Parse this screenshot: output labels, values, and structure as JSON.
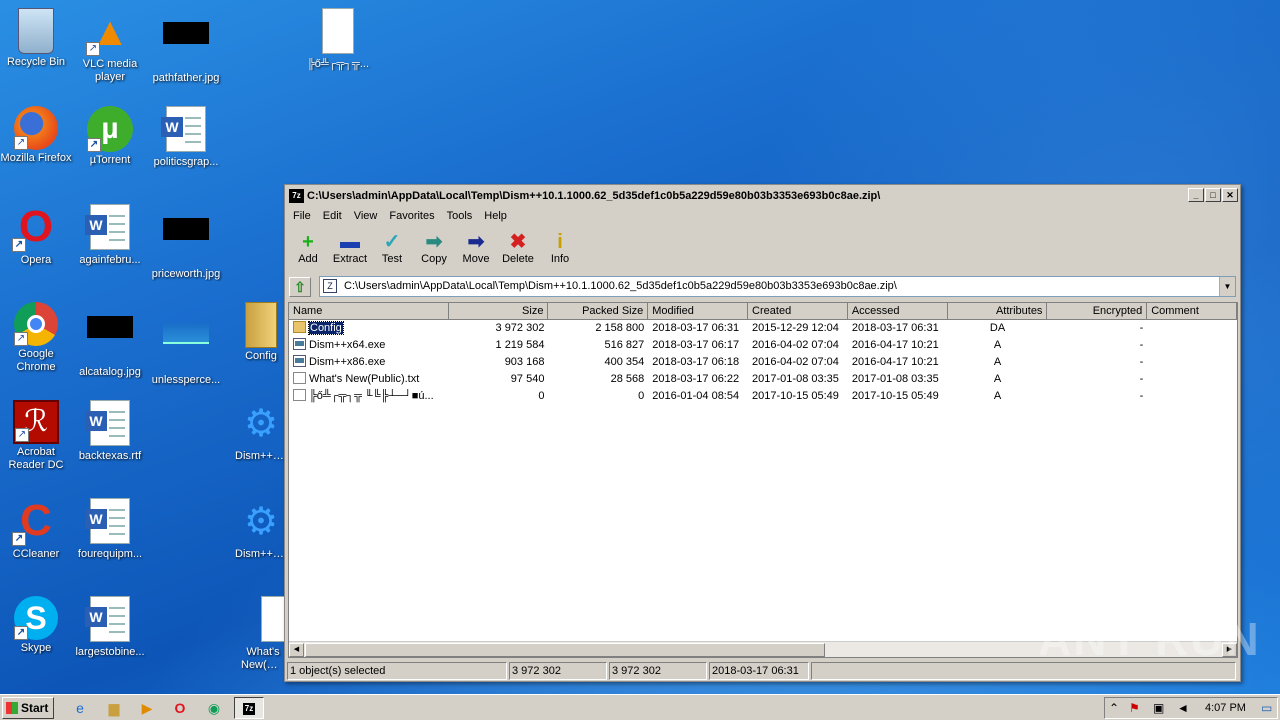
{
  "desktop": {
    "icons": [
      {
        "label": "Recycle Bin"
      },
      {
        "label": "VLC media player"
      },
      {
        "label": "pathfather.jpg"
      },
      {
        "label": "╠ő╩┌╦┐╦..."
      },
      {
        "label": "Mozilla Firefox"
      },
      {
        "label": "µTorrent"
      },
      {
        "label": "politicsgrap..."
      },
      {
        "label": "Opera"
      },
      {
        "label": "againfebru..."
      },
      {
        "label": "priceworth.jpg"
      },
      {
        "label": "Google Chrome"
      },
      {
        "label": "alcatalog.jpg"
      },
      {
        "label": "unlessperce..."
      },
      {
        "label": "Config"
      },
      {
        "label": "Acrobat Reader DC"
      },
      {
        "label": "backtexas.rtf"
      },
      {
        "label": "Dism++x6..."
      },
      {
        "label": "CCleaner"
      },
      {
        "label": "fourequipm..."
      },
      {
        "label": "Dism++x8..."
      },
      {
        "label": "Skype"
      },
      {
        "label": "largestobine..."
      },
      {
        "label": "What's New(Public)..."
      }
    ]
  },
  "window": {
    "title": "C:\\Users\\admin\\AppData\\Local\\Temp\\Dism++10.1.1000.62_5d35def1c0b5a229d59e80b03b3353e693b0c8ae.zip\\",
    "app_icon": "7z",
    "menu": [
      "File",
      "Edit",
      "View",
      "Favorites",
      "Tools",
      "Help"
    ],
    "toolbar": [
      {
        "label": "Add",
        "icon": "+",
        "color": "#19b019"
      },
      {
        "label": "Extract",
        "icon": "▬",
        "color": "#1a3fb0"
      },
      {
        "label": "Test",
        "icon": "✓",
        "color": "#29a8b8"
      },
      {
        "label": "Copy",
        "icon": "➡",
        "color": "#2a8a80"
      },
      {
        "label": "Move",
        "icon": "➡",
        "color": "#1a2a90"
      },
      {
        "label": "Delete",
        "icon": "✖",
        "color": "#d42020"
      },
      {
        "label": "Info",
        "icon": "i",
        "color": "#c8a000"
      }
    ],
    "address": "C:\\Users\\admin\\AppData\\Local\\Temp\\Dism++10.1.1000.62_5d35def1c0b5a229d59e80b03b3353e693b0c8ae.zip\\",
    "columns": [
      "Name",
      "Size",
      "Packed Size",
      "Modified",
      "Created",
      "Accessed",
      "Attributes",
      "Encrypted",
      "Comment"
    ],
    "rows": [
      {
        "type": "folder",
        "name": "Config",
        "size": "3 972 302",
        "packed": "2 158 800",
        "modified": "2018-03-17 06:31",
        "created": "2015-12-29 12:04",
        "accessed": "2018-03-17 06:31",
        "attr": "DA",
        "enc": "-",
        "comment": ""
      },
      {
        "type": "exe",
        "name": "Dism++x64.exe",
        "size": "1 219 584",
        "packed": "516 827",
        "modified": "2018-03-17 06:17",
        "created": "2016-04-02 07:04",
        "accessed": "2016-04-17 10:21",
        "attr": "A",
        "enc": "-",
        "comment": ""
      },
      {
        "type": "exe",
        "name": "Dism++x86.exe",
        "size": "903 168",
        "packed": "400 354",
        "modified": "2018-03-17 06:18",
        "created": "2016-04-02 07:04",
        "accessed": "2016-04-17 10:21",
        "attr": "A",
        "enc": "-",
        "comment": ""
      },
      {
        "type": "txt",
        "name": "What's New(Public).txt",
        "size": "97 540",
        "packed": "28 568",
        "modified": "2018-03-17 06:22",
        "created": "2017-01-08 03:35",
        "accessed": "2017-01-08 03:35",
        "attr": "A",
        "enc": "-",
        "comment": ""
      },
      {
        "type": "txt",
        "name": "╠ő╩┌╦┐╦ ╙╚╠┴─┘■ú...",
        "size": "0",
        "packed": "0",
        "modified": "2016-01-04 08:54",
        "created": "2017-10-15 05:49",
        "accessed": "2017-10-15 05:49",
        "attr": "A",
        "enc": "-",
        "comment": ""
      }
    ],
    "status": [
      "1 object(s) selected",
      "3 972 302",
      "3 972 302",
      "2018-03-17 06:31"
    ]
  },
  "watermark": "ANY RUN",
  "taskbar": {
    "start_label": "Start",
    "clock": "4:07 PM"
  }
}
